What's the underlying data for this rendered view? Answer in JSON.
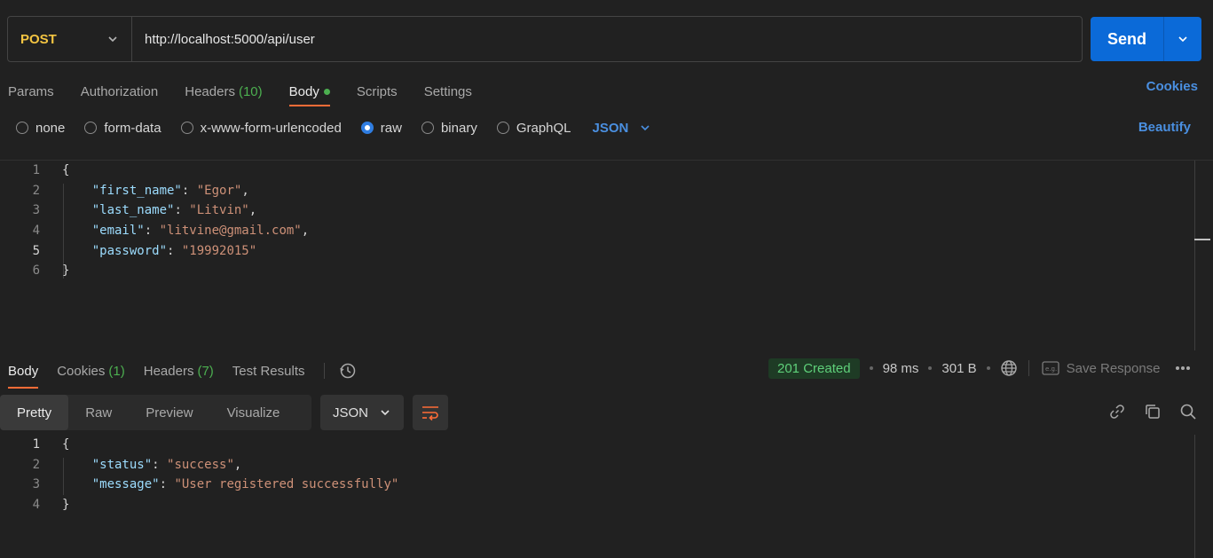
{
  "request": {
    "method": "POST",
    "url": "http://localhost:5000/api/user",
    "send_label": "Send"
  },
  "request_tabs": [
    {
      "label": "Params"
    },
    {
      "label": "Authorization"
    },
    {
      "label": "Headers",
      "count": "(10)"
    },
    {
      "label": "Body"
    },
    {
      "label": "Scripts"
    },
    {
      "label": "Settings"
    }
  ],
  "cookies_label": "Cookies",
  "body_types": [
    "none",
    "form-data",
    "x-www-form-urlencoded",
    "raw",
    "binary",
    "GraphQL"
  ],
  "body_format": "JSON",
  "beautify_label": "Beautify",
  "request_body": {
    "line_numbers": [
      "1",
      "2",
      "3",
      "4",
      "5",
      "6"
    ],
    "open_brace": "{",
    "close_brace": "}",
    "fields": [
      {
        "key": "\"first_name\"",
        "value": "\"Egor\"",
        "suffix": ","
      },
      {
        "key": "\"last_name\"",
        "value": "\"Litvin\"",
        "suffix": ","
      },
      {
        "key": "\"email\"",
        "value": "\"litvine@gmail.com\"",
        "suffix": ","
      },
      {
        "key": "\"password\"",
        "value": "\"19992015\"",
        "suffix": ""
      }
    ]
  },
  "response_tabs": [
    {
      "label": "Body"
    },
    {
      "label": "Cookies",
      "count": "(1)"
    },
    {
      "label": "Headers",
      "count": "(7)"
    },
    {
      "label": "Test Results"
    }
  ],
  "response_meta": {
    "status": "201 Created",
    "time": "98 ms",
    "size": "301 B",
    "save_label": "Save Response"
  },
  "view_modes": [
    "Pretty",
    "Raw",
    "Preview",
    "Visualize"
  ],
  "response_format": "JSON",
  "response_body": {
    "line_numbers": [
      "1",
      "2",
      "3",
      "4"
    ],
    "open_brace": "{",
    "close_brace": "}",
    "fields": [
      {
        "key": "\"status\"",
        "value": "\"success\"",
        "suffix": ","
      },
      {
        "key": "\"message\"",
        "value": "\"User registered successfully\"",
        "suffix": ""
      }
    ]
  },
  "colors": {
    "accent": "#ff6c37",
    "send": "#0b6ad8",
    "method": "#f4c542",
    "status_ok": "#5fd07a"
  }
}
